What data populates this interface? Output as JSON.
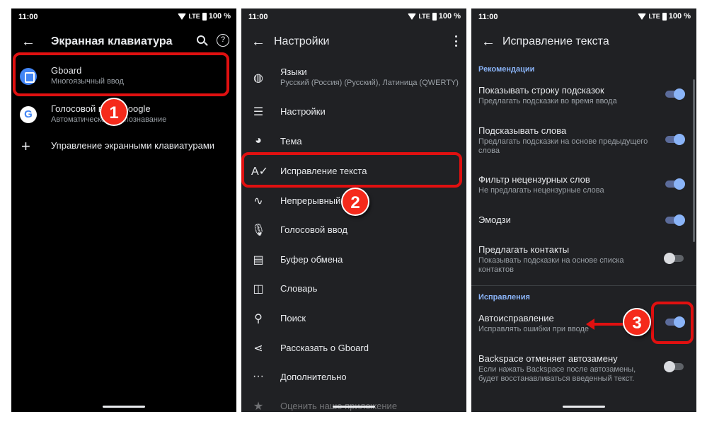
{
  "colors": {
    "accent": "#8ab4f8",
    "highlight": "#e01010",
    "badge": "#f52a1b"
  },
  "status": {
    "time": "11:00",
    "network": "LTE",
    "battery": "100 %"
  },
  "screen1": {
    "title": "Экранная клавиатура",
    "items": [
      {
        "title": "Gboard",
        "subtitle": "Многоязычный ввод",
        "icon": "gboard-icon"
      },
      {
        "title": "Голосовой ввод Google",
        "subtitle": "Автоматическое распознавание",
        "icon": "google-g-icon"
      },
      {
        "title": "Управление экранными клавиатурами",
        "icon": "plus-icon"
      }
    ],
    "badge": "1"
  },
  "screen2": {
    "title": "Настройки",
    "items": [
      {
        "title": "Языки",
        "subtitle": "Русский (Россия) (Русский), Латиница (QWERTY)",
        "icon": "globe-icon"
      },
      {
        "title": "Настройки",
        "icon": "sliders-icon"
      },
      {
        "title": "Тема",
        "icon": "palette-icon"
      },
      {
        "title": "Исправление текста",
        "icon": "spellcheck-icon"
      },
      {
        "title": "Непрерывный ввод",
        "icon": "gesture-icon"
      },
      {
        "title": "Голосовой ввод",
        "icon": "mic-icon"
      },
      {
        "title": "Буфер обмена",
        "icon": "clipboard-icon"
      },
      {
        "title": "Словарь",
        "icon": "book-icon"
      },
      {
        "title": "Поиск",
        "icon": "search-icon"
      },
      {
        "title": "Рассказать о Gboard",
        "icon": "share-icon"
      },
      {
        "title": "Дополнительно",
        "icon": "more-icon"
      },
      {
        "title": "Оценить наше приложение",
        "icon": "star-icon"
      }
    ],
    "badge": "2"
  },
  "screen3": {
    "title": "Исправление текста",
    "section1": "Рекомендации",
    "section2": "Исправления",
    "items": [
      {
        "title": "Показывать строку подсказок",
        "subtitle": "Предлагать подсказки во время ввода",
        "on": true
      },
      {
        "title": "Подсказывать слова",
        "subtitle": "Предлагать подсказки на основе предыдущего",
        "subtitle2": "слова",
        "on": true
      },
      {
        "title": "Фильтр нецензурных слов",
        "subtitle": "Не предлагать нецензурные слова",
        "on": true
      },
      {
        "title": "Эмодзи",
        "on": true
      },
      {
        "title": "Предлагать контакты",
        "subtitle": "Показывать подсказки на основе списка",
        "subtitle2": "контактов",
        "on": false
      },
      {
        "title": "Автоисправление",
        "subtitle": "Исправлять ошибки при вводе",
        "on": true
      },
      {
        "title": "Backspace отменяет автозамену",
        "subtitle": "Если нажать Backspace после автозамены,",
        "subtitle2": "будет восстанавливаться введенный текст.",
        "on": false
      }
    ],
    "badge": "3"
  }
}
